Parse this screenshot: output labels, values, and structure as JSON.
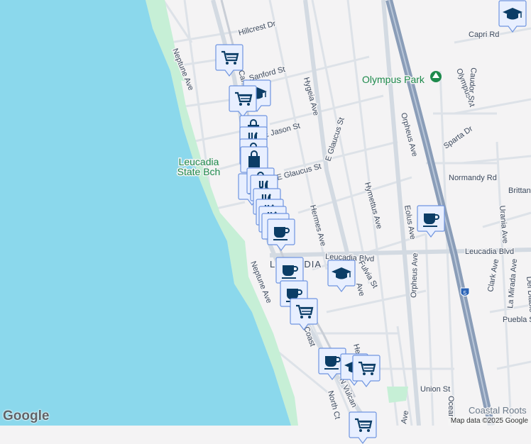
{
  "map": {
    "streets": {
      "hillcrest": "Hillcrest Dr",
      "neptune_n": "Neptune Ave",
      "neptune_s": "Neptune Ave",
      "sanford": "Sanford St",
      "jason": "E Jason St",
      "glaucus": "E Glaucus St",
      "glaucus_v": "E Glaucus St",
      "hygeia": "Hygeia Ave",
      "hermes": "Hermes Ave",
      "hymettus": "Hymettus Ave",
      "orpheus_n": "Orpheus Ave",
      "orpheus_s": "Orpheus Ave",
      "eolus": "Eolus Ave",
      "leucadia_blvd_w": "Leucadia Blvd",
      "leucadia_blvd_e": "Leucadia Blvd",
      "fulvia": "Fulvia St",
      "capri": "Capri Rd",
      "olympus": "Olympus St",
      "caudor": "Caudor St",
      "sparta": "Sparta Dr",
      "normandy": "Normandy Rd",
      "brittany": "Brittan",
      "urania": "Urania Ave",
      "clark": "Clark Ave",
      "la_mirada": "La Mirada Ave",
      "del_diablo": "Del Diablo",
      "puebla": "Puebla St",
      "union": "Union St",
      "north_ct": "North Ct",
      "coast": "Coast",
      "vulcan": "N Vulcan",
      "ocean": "Ocean",
      "ave": "Ave",
      "her": "Her",
      "cal": "Cal"
    },
    "places": {
      "leucadia_state_beach_1": "Leucadia",
      "leucadia_state_beach_2": "State Bch",
      "olympus_park": "Olympus Park",
      "leucadia": "LEUCADIA",
      "coastal_roots": "Coastal Roots"
    },
    "highway_shield": "5",
    "markers": [
      "shopping-cart",
      "education",
      "shopping-cart",
      "shopping-bag",
      "restaurant",
      "shopping-bag",
      "shopping-bag",
      "restaurant",
      "shopping-bag",
      "restaurant",
      "restaurant",
      "restaurant",
      "restaurant",
      "restaurant",
      "coffee",
      "education",
      "coffee",
      "coffee",
      "shopping-cart",
      "coffee",
      "education",
      "shopping-cart",
      "shopping-cart",
      "coffee",
      "education"
    ],
    "logo": "Google",
    "attribution": "Map data ©2025 Google",
    "colors": {
      "water": "#8bd8ec",
      "land": "#f4f3f4",
      "park": "#c6efd6",
      "road": "#d9dee5",
      "highway": "#8a9db8",
      "marker_fill": "#e8efff",
      "marker_border": "#6f95e0",
      "icon": "#0b3d66"
    }
  }
}
